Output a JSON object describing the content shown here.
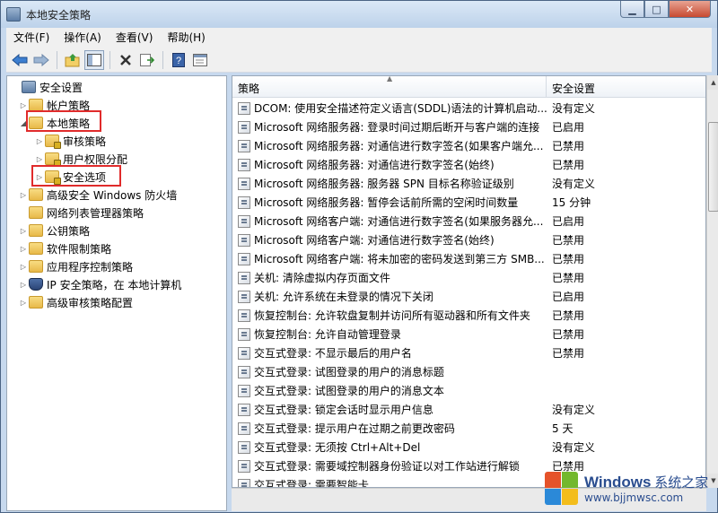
{
  "window": {
    "title": "本地安全策略"
  },
  "menu": [
    "文件(F)",
    "操作(A)",
    "查看(V)",
    "帮助(H)"
  ],
  "toolbar": [
    "back-icon",
    "forward-icon",
    "up-folder-icon",
    "show-hide-tree-icon",
    "delete-icon",
    "export-list-icon",
    "help-icon",
    "properties-icon"
  ],
  "tree": [
    {
      "label": "安全设置",
      "icon": "security-settings-icon"
    },
    {
      "label": "帐户策略",
      "icon": "folder-icon"
    },
    {
      "label": "本地策略",
      "icon": "folder-icon"
    },
    {
      "label": "审核策略",
      "icon": "folder-icon"
    },
    {
      "label": "用户权限分配",
      "icon": "folder-icon"
    },
    {
      "label": "安全选项",
      "icon": "folder-icon"
    },
    {
      "label": "高级安全 Windows 防火墙",
      "icon": "folder-icon"
    },
    {
      "label": "网络列表管理器策略",
      "icon": "folder-icon"
    },
    {
      "label": "公钥策略",
      "icon": "folder-icon"
    },
    {
      "label": "软件限制策略",
      "icon": "folder-icon"
    },
    {
      "label": "应用程序控制策略",
      "icon": "folder-icon"
    },
    {
      "label": "IP 安全策略，在 本地计算机",
      "icon": "shield-icon"
    },
    {
      "label": "高级审核策略配置",
      "icon": "folder-icon"
    }
  ],
  "columns": {
    "policy": "策略",
    "setting": "安全设置"
  },
  "rows": [
    {
      "policy": "DCOM: 使用安全描述符定义语言(SDDL)语法的计算机启动...",
      "setting": "没有定义"
    },
    {
      "policy": "Microsoft 网络服务器: 登录时间过期后断开与客户端的连接",
      "setting": "已启用"
    },
    {
      "policy": "Microsoft 网络服务器: 对通信进行数字签名(如果客户端允...",
      "setting": "已禁用"
    },
    {
      "policy": "Microsoft 网络服务器: 对通信进行数字签名(始终)",
      "setting": "已禁用"
    },
    {
      "policy": "Microsoft 网络服务器: 服务器 SPN 目标名称验证级别",
      "setting": "没有定义"
    },
    {
      "policy": "Microsoft 网络服务器: 暂停会话前所需的空闲时间数量",
      "setting": "15 分钟"
    },
    {
      "policy": "Microsoft 网络客户端: 对通信进行数字签名(如果服务器允...",
      "setting": "已启用"
    },
    {
      "policy": "Microsoft 网络客户端: 对通信进行数字签名(始终)",
      "setting": "已禁用"
    },
    {
      "policy": "Microsoft 网络客户端: 将未加密的密码发送到第三方 SMB...",
      "setting": "已禁用"
    },
    {
      "policy": "关机: 清除虚拟内存页面文件",
      "setting": "已禁用"
    },
    {
      "policy": "关机: 允许系统在未登录的情况下关闭",
      "setting": "已启用"
    },
    {
      "policy": "恢复控制台: 允许软盘复制并访问所有驱动器和所有文件夹",
      "setting": "已禁用"
    },
    {
      "policy": "恢复控制台: 允许自动管理登录",
      "setting": "已禁用"
    },
    {
      "policy": "交互式登录: 不显示最后的用户名",
      "setting": "已禁用"
    },
    {
      "policy": "交互式登录: 试图登录的用户的消息标题",
      "setting": ""
    },
    {
      "policy": "交互式登录: 试图登录的用户的消息文本",
      "setting": ""
    },
    {
      "policy": "交互式登录: 锁定会话时显示用户信息",
      "setting": "没有定义"
    },
    {
      "policy": "交互式登录: 提示用户在过期之前更改密码",
      "setting": "5 天"
    },
    {
      "policy": "交互式登录: 无须按 Ctrl+Alt+Del",
      "setting": "没有定义"
    },
    {
      "policy": "交互式登录: 需要域控制器身份验证以对工作站进行解锁",
      "setting": "已禁用"
    },
    {
      "policy": "交互式登录: 需要智能卡",
      "setting": ""
    }
  ],
  "watermark": {
    "brand": "Windows",
    "brand_cn": "系统之家",
    "url": "www.bjjmwsc.com"
  }
}
